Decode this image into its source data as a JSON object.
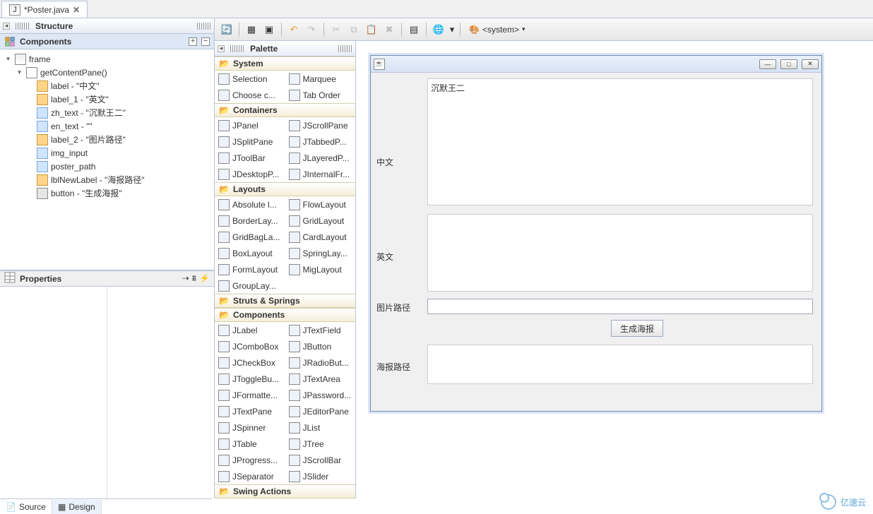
{
  "tabs": {
    "poster": "*Poster.java"
  },
  "structure": {
    "title": "Structure",
    "components_title": "Components",
    "tree": {
      "frame": "frame",
      "content_pane": "getContentPane()",
      "nodes": [
        {
          "key": "label",
          "icon": "label",
          "text": "label - \"中文\""
        },
        {
          "key": "label_1",
          "icon": "label",
          "text": "label_1 - \"英文\""
        },
        {
          "key": "zh_text",
          "icon": "text",
          "text": "zh_text - \"沉默王二\""
        },
        {
          "key": "en_text",
          "icon": "text",
          "text": "en_text - \"\""
        },
        {
          "key": "label_2",
          "icon": "label",
          "text": "label_2 - \"图片路径\""
        },
        {
          "key": "img_input",
          "icon": "text",
          "text": "img_input"
        },
        {
          "key": "poster_path",
          "icon": "text",
          "text": "poster_path"
        },
        {
          "key": "lblNewLabel",
          "icon": "label",
          "text": "lblNewLabel - \"海报路径\""
        },
        {
          "key": "button",
          "icon": "btn",
          "text": "button - \"生成海报\""
        }
      ]
    }
  },
  "properties": {
    "title": "Properties"
  },
  "palette": {
    "title": "Palette",
    "groups": {
      "system": {
        "label": "System",
        "items": [
          "Selection",
          "Marquee",
          "Choose c...",
          "Tab Order"
        ]
      },
      "containers": {
        "label": "Containers",
        "items": [
          "JPanel",
          "JScrollPane",
          "JSplitPane",
          "JTabbedP...",
          "JToolBar",
          "JLayeredP...",
          "JDesktopP...",
          "JInternalFr..."
        ]
      },
      "layouts": {
        "label": "Layouts",
        "items": [
          "Absolute l...",
          "FlowLayout",
          "BorderLay...",
          "GridLayout",
          "GridBagLa...",
          "CardLayout",
          "BoxLayout",
          "SpringLay...",
          "FormLayout",
          "MigLayout",
          "GroupLay..."
        ]
      },
      "struts": {
        "label": "Struts & Springs"
      },
      "components": {
        "label": "Components",
        "items": [
          "JLabel",
          "JTextField",
          "JComboBox",
          "JButton",
          "JCheckBox",
          "JRadioBut...",
          "JToggleBu...",
          "JTextArea",
          "JFormatte...",
          "JPassword...",
          "JTextPane",
          "JEditorPane",
          "JSpinner",
          "JList",
          "JTable",
          "JTree",
          "JProgress...",
          "JScrollBar",
          "JSeparator",
          "JSlider"
        ]
      },
      "swing_actions": {
        "label": "Swing Actions"
      }
    }
  },
  "toolbar": {
    "system_label": "<system>"
  },
  "form": {
    "labels": {
      "zh": "中文",
      "en": "英文",
      "img": "图片路径",
      "poster": "海报路径"
    },
    "zh_value": "沉默王二",
    "en_value": "",
    "img_value": "",
    "poster_value": "",
    "button": "生成海报"
  },
  "bottom_tabs": {
    "source": "Source",
    "design": "Design"
  },
  "watermark": "亿速云"
}
